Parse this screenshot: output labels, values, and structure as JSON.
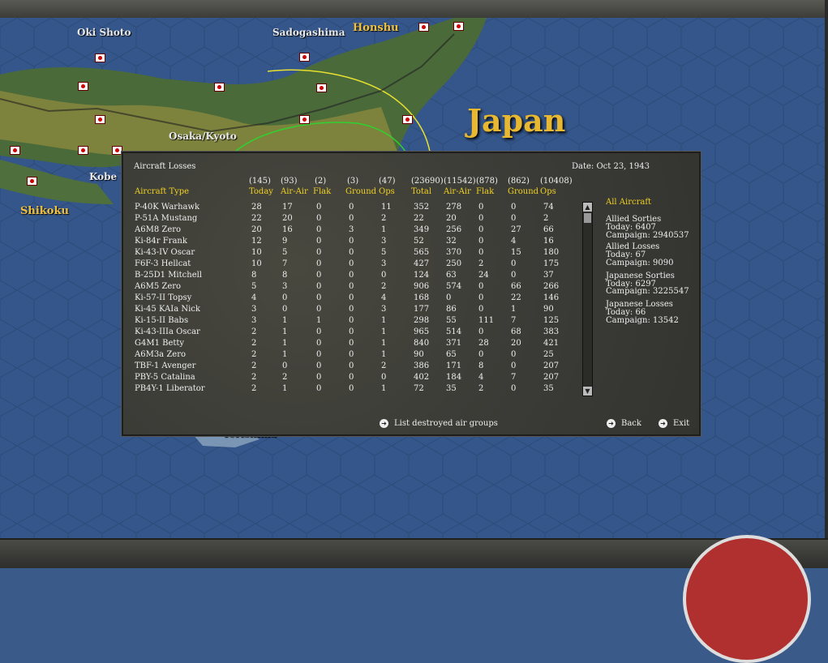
{
  "map": {
    "labels": {
      "oki": "Oki Shoto",
      "sado": "Sadogashima",
      "honshu": "Honshu",
      "japan": "Japan",
      "osaka": "Osaka/Kyoto",
      "kobe": "Kobe",
      "shikoku": "Shikoku",
      "torishima": "Torishima"
    }
  },
  "panel": {
    "title": "Aircraft Losses",
    "date": "Date: Oct 23, 1943",
    "totals": [
      "(145)",
      "(93)",
      "(2)",
      "(3)",
      "(47)",
      "(23690)",
      "(11542)",
      "(878)",
      "(862)",
      "(10408)"
    ],
    "columns": {
      "type": "Aircraft Type",
      "today": "Today",
      "air_air": "Air-Air",
      "flak": "Flak",
      "ground": "Ground",
      "ops": "Ops",
      "total": "Total",
      "air_air2": "Air-Air",
      "flak2": "Flak",
      "ground2": "Ground",
      "ops2": "Ops"
    },
    "rows": [
      [
        "P-40K Warhawk",
        "28",
        "17",
        "0",
        "0",
        "11",
        "352",
        "278",
        "0",
        "0",
        "74"
      ],
      [
        "P-51A Mustang",
        "22",
        "20",
        "0",
        "0",
        "2",
        "22",
        "20",
        "0",
        "0",
        "2"
      ],
      [
        "A6M8 Zero",
        "20",
        "16",
        "0",
        "3",
        "1",
        "349",
        "256",
        "0",
        "27",
        "66"
      ],
      [
        "Ki-84r Frank",
        "12",
        "9",
        "0",
        "0",
        "3",
        "52",
        "32",
        "0",
        "4",
        "16"
      ],
      [
        "Ki-43-IV Oscar",
        "10",
        "5",
        "0",
        "0",
        "5",
        "565",
        "370",
        "0",
        "15",
        "180"
      ],
      [
        "F6F-3 Hellcat",
        "10",
        "7",
        "0",
        "0",
        "3",
        "427",
        "250",
        "2",
        "0",
        "175"
      ],
      [
        "B-25D1 Mitchell",
        "8",
        "8",
        "0",
        "0",
        "0",
        "124",
        "63",
        "24",
        "0",
        "37"
      ],
      [
        "A6M5 Zero",
        "5",
        "3",
        "0",
        "0",
        "2",
        "906",
        "574",
        "0",
        "66",
        "266"
      ],
      [
        "Ki-57-II Topsy",
        "4",
        "0",
        "0",
        "0",
        "4",
        "168",
        "0",
        "0",
        "22",
        "146"
      ],
      [
        "Ki-45 KAIa Nick",
        "3",
        "0",
        "0",
        "0",
        "3",
        "177",
        "86",
        "0",
        "1",
        "90"
      ],
      [
        "Ki-15-II Babs",
        "3",
        "1",
        "1",
        "0",
        "1",
        "298",
        "55",
        "111",
        "7",
        "125"
      ],
      [
        "Ki-43-IIIa Oscar",
        "2",
        "1",
        "0",
        "0",
        "1",
        "965",
        "514",
        "0",
        "68",
        "383"
      ],
      [
        "G4M1 Betty",
        "2",
        "1",
        "0",
        "0",
        "1",
        "840",
        "371",
        "28",
        "20",
        "421"
      ],
      [
        "A6M3a Zero",
        "2",
        "1",
        "0",
        "0",
        "1",
        "90",
        "65",
        "0",
        "0",
        "25"
      ],
      [
        "TBF-1 Avenger",
        "2",
        "0",
        "0",
        "0",
        "2",
        "386",
        "171",
        "8",
        "0",
        "207"
      ],
      [
        "PBY-5 Catalina",
        "2",
        "2",
        "0",
        "0",
        "0",
        "402",
        "184",
        "4",
        "7",
        "207"
      ],
      [
        "PB4Y-1 Liberator",
        "2",
        "1",
        "0",
        "0",
        "1",
        "72",
        "35",
        "2",
        "0",
        "35"
      ]
    ],
    "side": {
      "all": "All Aircraft",
      "allied_sorties": "Allied Sorties",
      "allied_sorties_today": "Today:   6407",
      "allied_sorties_campaign": "Campaign: 2940537",
      "allied_losses": "Allied Losses",
      "allied_losses_today": "Today:   67",
      "allied_losses_campaign": "Campaign: 9090",
      "japanese_sorties": "Japanese Sorties",
      "japanese_sorties_today": "Today:   6297",
      "japanese_sorties_campaign": "Campaign: 3225547",
      "japanese_losses": "Japanese Losses",
      "japanese_losses_today": "Today:   66",
      "japanese_losses_campaign": "Campaign: 13542"
    },
    "buttons": {
      "list": "List destroyed air groups",
      "back": "Back",
      "exit": "Exit"
    }
  }
}
